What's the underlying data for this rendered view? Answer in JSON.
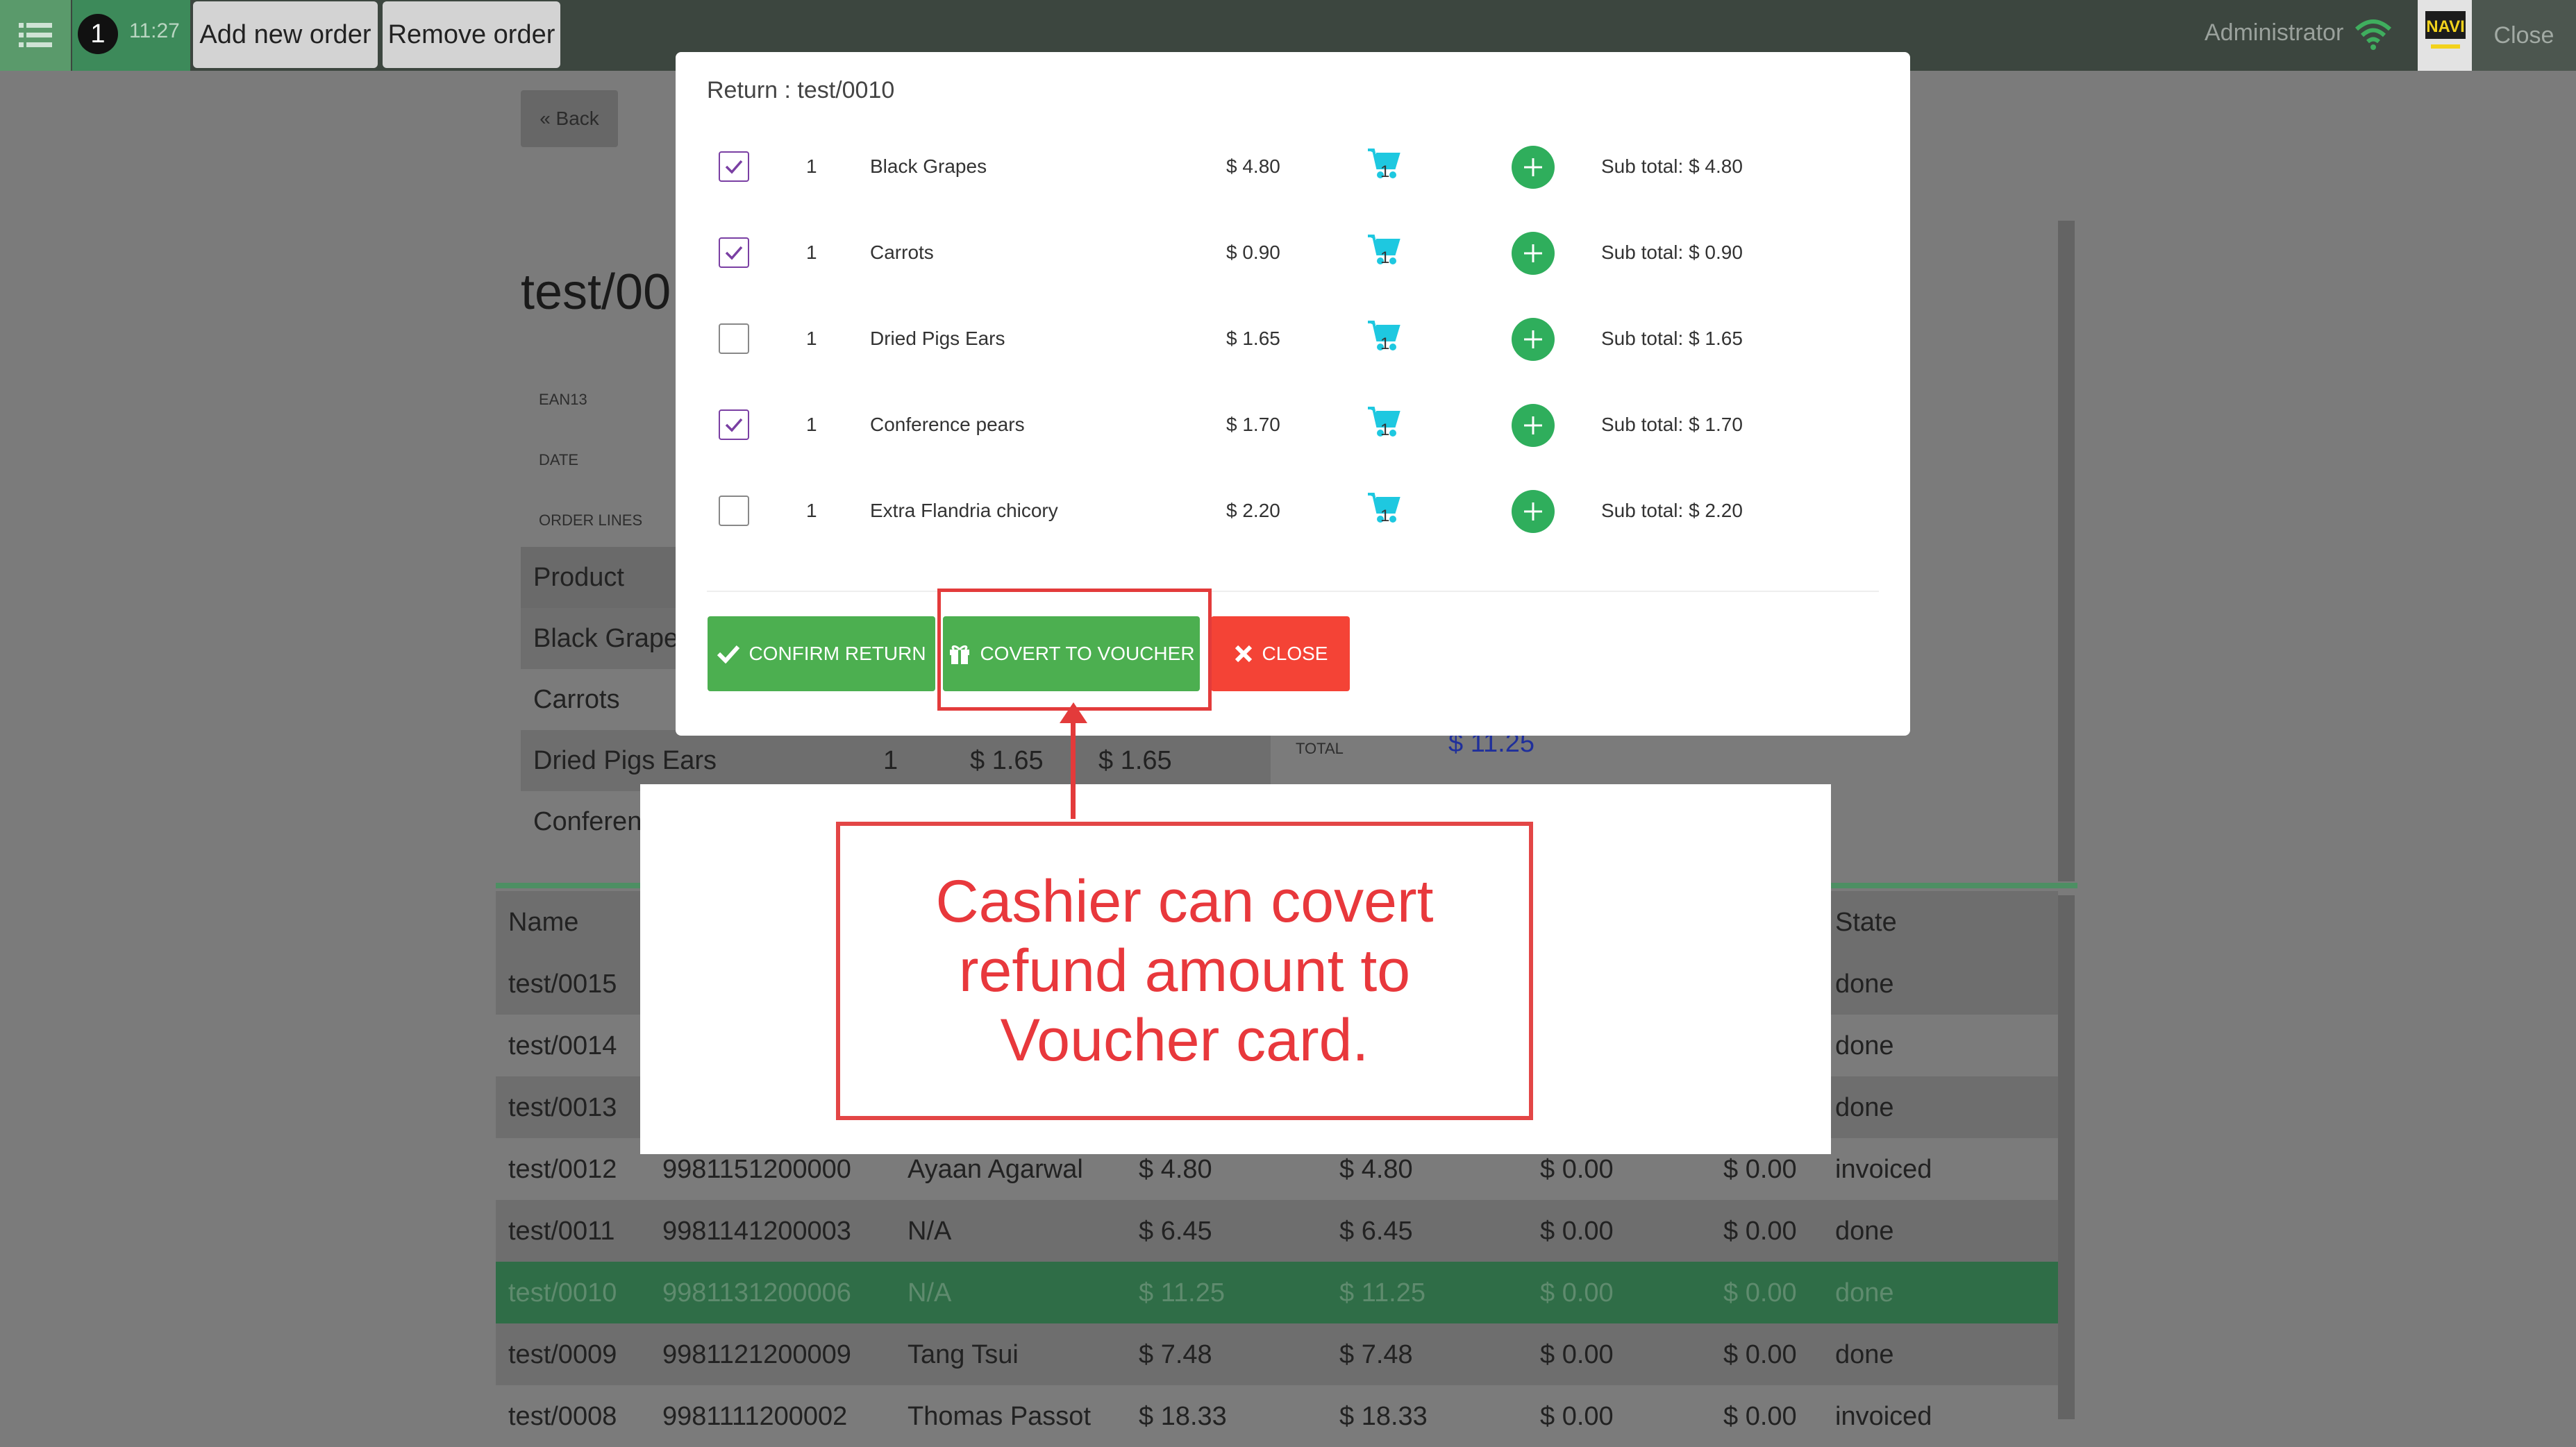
{
  "topbar": {
    "order_number": "1",
    "order_time": "11:27",
    "add_order_label": "Add new order",
    "remove_order_label": "Remove order",
    "user": "Administrator",
    "close_label": "Close",
    "logo_text": "NAVI"
  },
  "page": {
    "back_label": "« Back",
    "order_title": "test/00",
    "labels": {
      "ean": "EAN13",
      "date": "DATE",
      "order_lines": "ORDER LINES",
      "total": "TOTAL"
    },
    "total_value": "$ 11.25",
    "lines_header": "Product",
    "lines": [
      {
        "product": "Black Grapes",
        "qty": "",
        "price": "",
        "subtotal": ""
      },
      {
        "product": "Carrots",
        "qty": "",
        "price": "",
        "subtotal": ""
      },
      {
        "product": "Dried Pigs Ears",
        "qty": "1",
        "price": "$ 1.65",
        "subtotal": "$ 1.65"
      },
      {
        "product": "Conferenc",
        "qty": "",
        "price": "",
        "subtotal": ""
      }
    ]
  },
  "orders_table": {
    "headers": {
      "name": "Name",
      "state": "State"
    },
    "rows": [
      {
        "name": "test/0015",
        "ean": "",
        "customer": "",
        "total": "",
        "paid": "",
        "c1": "",
        "c2": "",
        "state": "done"
      },
      {
        "name": "test/0014",
        "ean": "",
        "customer": "",
        "total": "",
        "paid": "",
        "c1": "",
        "c2": "",
        "state": "done"
      },
      {
        "name": "test/0013",
        "ean": "",
        "customer": "",
        "total": "",
        "paid": "",
        "c1": "",
        "c2": "",
        "state": "done"
      },
      {
        "name": "test/0012",
        "ean": "9981151200000",
        "customer": "Ayaan Agarwal",
        "total": "$ 4.80",
        "paid": "$ 4.80",
        "c1": "$ 0.00",
        "c2": "$ 0.00",
        "state": "invoiced"
      },
      {
        "name": "test/0011",
        "ean": "9981141200003",
        "customer": "N/A",
        "total": "$ 6.45",
        "paid": "$ 6.45",
        "c1": "$ 0.00",
        "c2": "$ 0.00",
        "state": "done"
      },
      {
        "name": "test/0010",
        "ean": "9981131200006",
        "customer": "N/A",
        "total": "$ 11.25",
        "paid": "$ 11.25",
        "c1": "$ 0.00",
        "c2": "$ 0.00",
        "state": "done"
      },
      {
        "name": "test/0009",
        "ean": "9981121200009",
        "customer": "Tang Tsui",
        "total": "$ 7.48",
        "paid": "$ 7.48",
        "c1": "$ 0.00",
        "c2": "$ 0.00",
        "state": "done"
      },
      {
        "name": "test/0008",
        "ean": "9981111200002",
        "customer": "Thomas Passot",
        "total": "$ 18.33",
        "paid": "$ 18.33",
        "c1": "$ 0.00",
        "c2": "$ 0.00",
        "state": "invoiced"
      }
    ]
  },
  "modal": {
    "title": "Return : test/0010",
    "lines": [
      {
        "checked": true,
        "qty": "1",
        "product": "Black Grapes",
        "price": "$ 4.80",
        "cart_qty": "1",
        "subtotal": "Sub total: $ 4.80"
      },
      {
        "checked": true,
        "qty": "1",
        "product": "Carrots",
        "price": "$ 0.90",
        "cart_qty": "1",
        "subtotal": "Sub total: $ 0.90"
      },
      {
        "checked": false,
        "qty": "1",
        "product": "Dried Pigs Ears",
        "price": "$ 1.65",
        "cart_qty": "1",
        "subtotal": "Sub total: $ 1.65"
      },
      {
        "checked": true,
        "qty": "1",
        "product": "Conference pears",
        "price": "$ 1.70",
        "cart_qty": "1",
        "subtotal": "Sub total: $ 1.70"
      },
      {
        "checked": false,
        "qty": "1",
        "product": "Extra Flandria chicory",
        "price": "$ 2.20",
        "cart_qty": "1",
        "subtotal": "Sub total: $ 2.20"
      }
    ],
    "confirm_label": "CONFIRM RETURN",
    "voucher_label": "COVERT TO VOUCHER",
    "close_label": "CLOSE"
  },
  "annotation": {
    "text": "Cashier can covert refund amount to Voucher card."
  },
  "colors": {
    "topbar": "#3c463f",
    "accent_green": "#4caf50",
    "close_red": "#f44336",
    "annotation_red": "#e8383c",
    "selected_row": "#2f6d47",
    "cart_cyan": "#1ec8e0"
  },
  "icons": [
    "list-icon",
    "wifi-icon",
    "check-icon",
    "gift-icon",
    "x-icon",
    "cart-icon",
    "plus-icon"
  ]
}
